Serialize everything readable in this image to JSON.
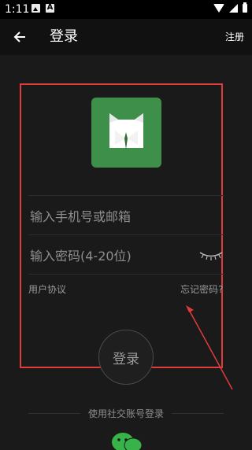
{
  "status_bar": {
    "time": "1:11"
  },
  "app_bar": {
    "title": "登录",
    "register_label": "注册"
  },
  "form": {
    "phone_placeholder": "输入手机号或邮箱",
    "password_placeholder": "输入密码(4-20位)",
    "agreement_label": "用户协议",
    "forgot_label": "忘记密码?",
    "login_label": "登录"
  },
  "social": {
    "label": "使用社交账号登录"
  },
  "colors": {
    "highlight": "#e23b3b",
    "logo_bg": "#3d8f4a",
    "background": "#1a1a1a"
  },
  "icons": [
    "wifi-icon",
    "signal-icon",
    "battery-icon",
    "back-arrow-icon",
    "eye-closed-icon",
    "wechat-icon",
    "cat-logo-icon"
  ]
}
